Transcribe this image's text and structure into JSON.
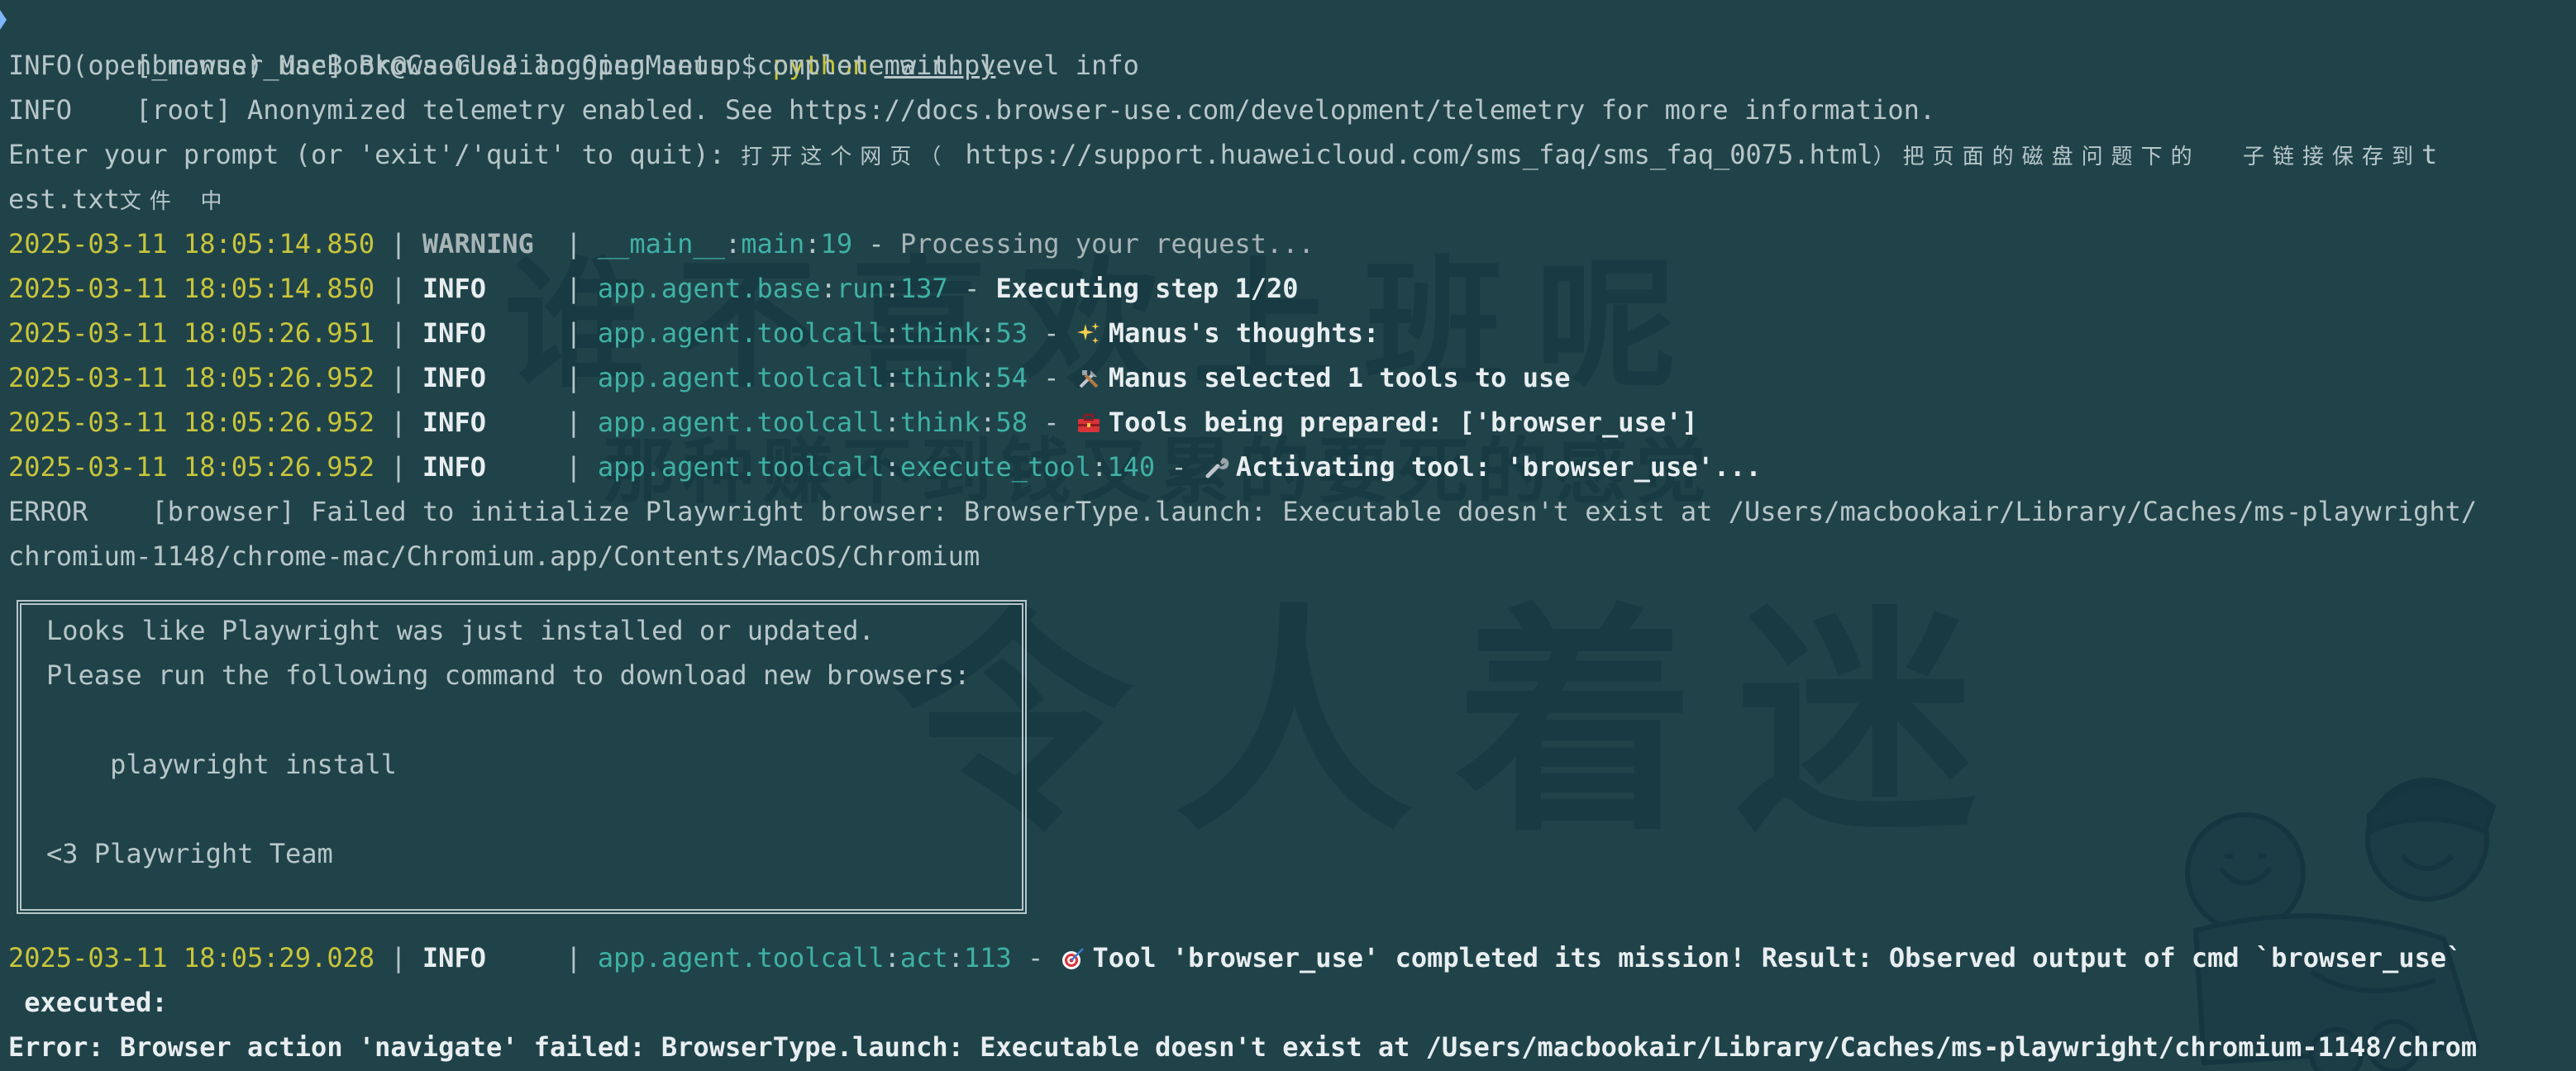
{
  "prompt": {
    "env": "(open_manus)",
    "user_host": "MacBook@CaoGuoJian",
    "dir": "OpenManus",
    "symbol": "$",
    "command": "python",
    "arg": "main.py"
  },
  "log_setup": [
    {
      "level": "INFO",
      "text": "    [browser_use] BrowserUse logging setup complete with level info"
    },
    {
      "level": "INFO",
      "text": "    [root] Anonymized telemetry enabled. See https://docs.browser-use.com/development/telemetry for more information."
    }
  ],
  "user_prompt": {
    "label": "Enter your prompt (or 'exit'/'quit' to quit): ",
    "cn1": "打开这个网页（",
    "url": " https://support.huaweicloud.com/sms_faq/sms_faq_0075.html",
    "cn2": "）把页面的磁盘问题下的  子链接保存到",
    "t": "t",
    "wrap": "est.txt",
    "cn3": "文件 中"
  },
  "entries": [
    {
      "ts": "2025-03-11 18:05:14.850",
      "sep": " | ",
      "level": "WARNING ",
      "sep2": " | ",
      "module": "__main__",
      "func": "main",
      "line": "19",
      "dash": " - ",
      "icon": "",
      "msg": "Processing your request..."
    },
    {
      "ts": "2025-03-11 18:05:14.850",
      "sep": " | ",
      "level": "INFO    ",
      "sep2": " | ",
      "module": "app.agent.base",
      "func": "run",
      "line": "137",
      "dash": " - ",
      "icon": "",
      "msg": "Executing step 1/20"
    },
    {
      "ts": "2025-03-11 18:05:26.951",
      "sep": " | ",
      "level": "INFO    ",
      "sep2": " | ",
      "module": "app.agent.toolcall",
      "func": "think",
      "line": "53",
      "dash": " - ",
      "icon": "sparkles-icon",
      "msg": "Manus's thoughts:"
    },
    {
      "ts": "2025-03-11 18:05:26.952",
      "sep": " | ",
      "level": "INFO    ",
      "sep2": " | ",
      "module": "app.agent.toolcall",
      "func": "think",
      "line": "54",
      "dash": " - ",
      "icon": "tools-icon",
      "msg": "Manus selected 1 tools to use"
    },
    {
      "ts": "2025-03-11 18:05:26.952",
      "sep": " | ",
      "level": "INFO    ",
      "sep2": " | ",
      "module": "app.agent.toolcall",
      "func": "think",
      "line": "58",
      "dash": " - ",
      "icon": "toolbox-icon",
      "msg": "Tools being prepared: ['browser_use']"
    },
    {
      "ts": "2025-03-11 18:05:26.952",
      "sep": " | ",
      "level": "INFO    ",
      "sep2": " | ",
      "module": "app.agent.toolcall",
      "func": "execute_tool",
      "line": "140",
      "dash": " - ",
      "icon": "wrench-icon",
      "msg": "Activating tool: 'browser_use'..."
    }
  ],
  "error_browser": {
    "l1": "ERROR    [browser] Failed to initialize Playwright browser: BrowserType.launch: Executable doesn't exist at /Users/macbookair/Library/Caches/ms-playwright/",
    "l2": "chromium-1148/chrome-mac/Chromium.app/Contents/MacOS/Chromium"
  },
  "box": {
    "l1": "Looks like Playwright was just installed or updated.",
    "l2": "Please run the following command to download new browsers:",
    "l3": "    playwright install",
    "l4": "<3 Playwright Team"
  },
  "final_entry": {
    "ts": "2025-03-11 18:05:29.028",
    "sep": " | ",
    "level": "INFO    ",
    "sep2": " | ",
    "module": "app.agent.toolcall",
    "func": "act",
    "line": "113",
    "dash": " - ",
    "icon": "target-icon",
    "msg": "Tool 'browser_use' completed its mission! Result: Observed output of cmd `browser_use`",
    "wrap": " executed:",
    "error": "Error: Browser action 'navigate' failed: BrowserType.launch: Executable doesn't exist at /Users/macbookair/Library/Caches/ms-playwright/chromium-1148/chrom"
  },
  "watermark": {
    "line1": "谁不喜欢上班呢",
    "line2": "那种赚不到钱又累的要死的感觉",
    "line3": "令人着迷"
  },
  "colors": {
    "background": "#20434a",
    "timestamp": "#c9c53a",
    "module": "#3fb1a5",
    "text": "#b8c6c8"
  }
}
